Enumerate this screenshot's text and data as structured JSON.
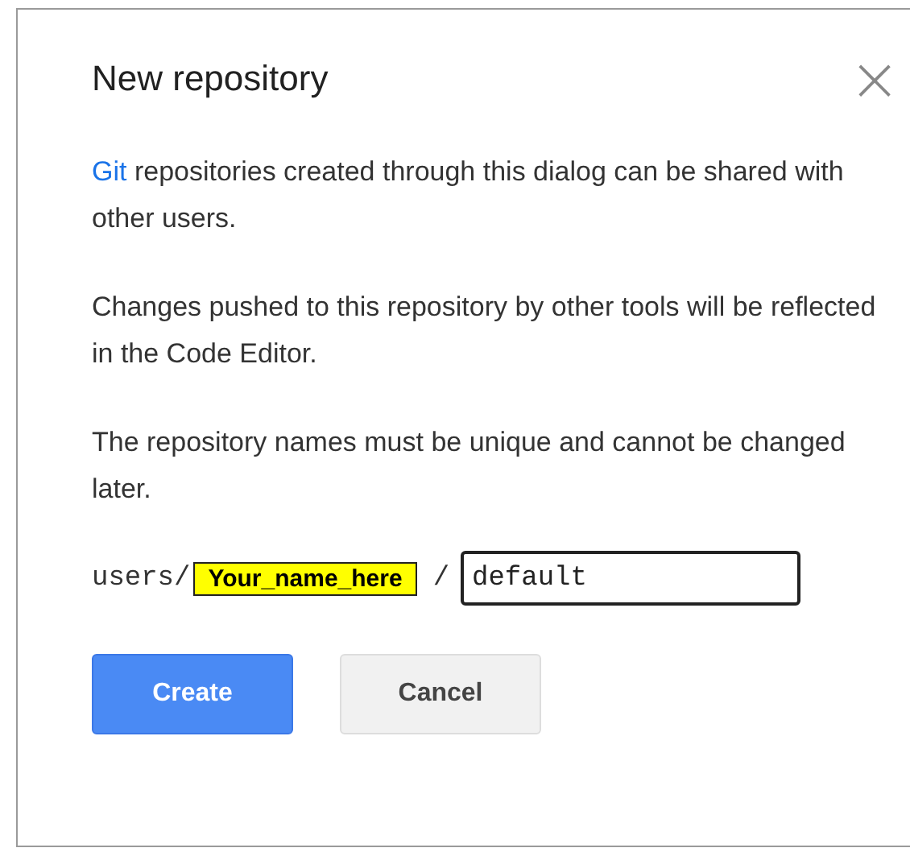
{
  "dialog": {
    "title": "New repository",
    "close": "×"
  },
  "paragraphs": [
    {
      "link": "Git",
      "text": " repositories created through this dialog can be shared with other users."
    },
    {
      "text": "Changes pushed to this repository by other tools will be reflected in the Code Editor."
    },
    {
      "text": "The repository names must be unique and cannot be changed later."
    }
  ],
  "path": {
    "prefix": "users/",
    "name_label": "Your_name_here",
    "separator": "/",
    "value": "default"
  },
  "buttons": [
    {
      "label": "Create",
      "kind": "primary"
    },
    {
      "label": "Cancel",
      "kind": "secondary"
    }
  ]
}
